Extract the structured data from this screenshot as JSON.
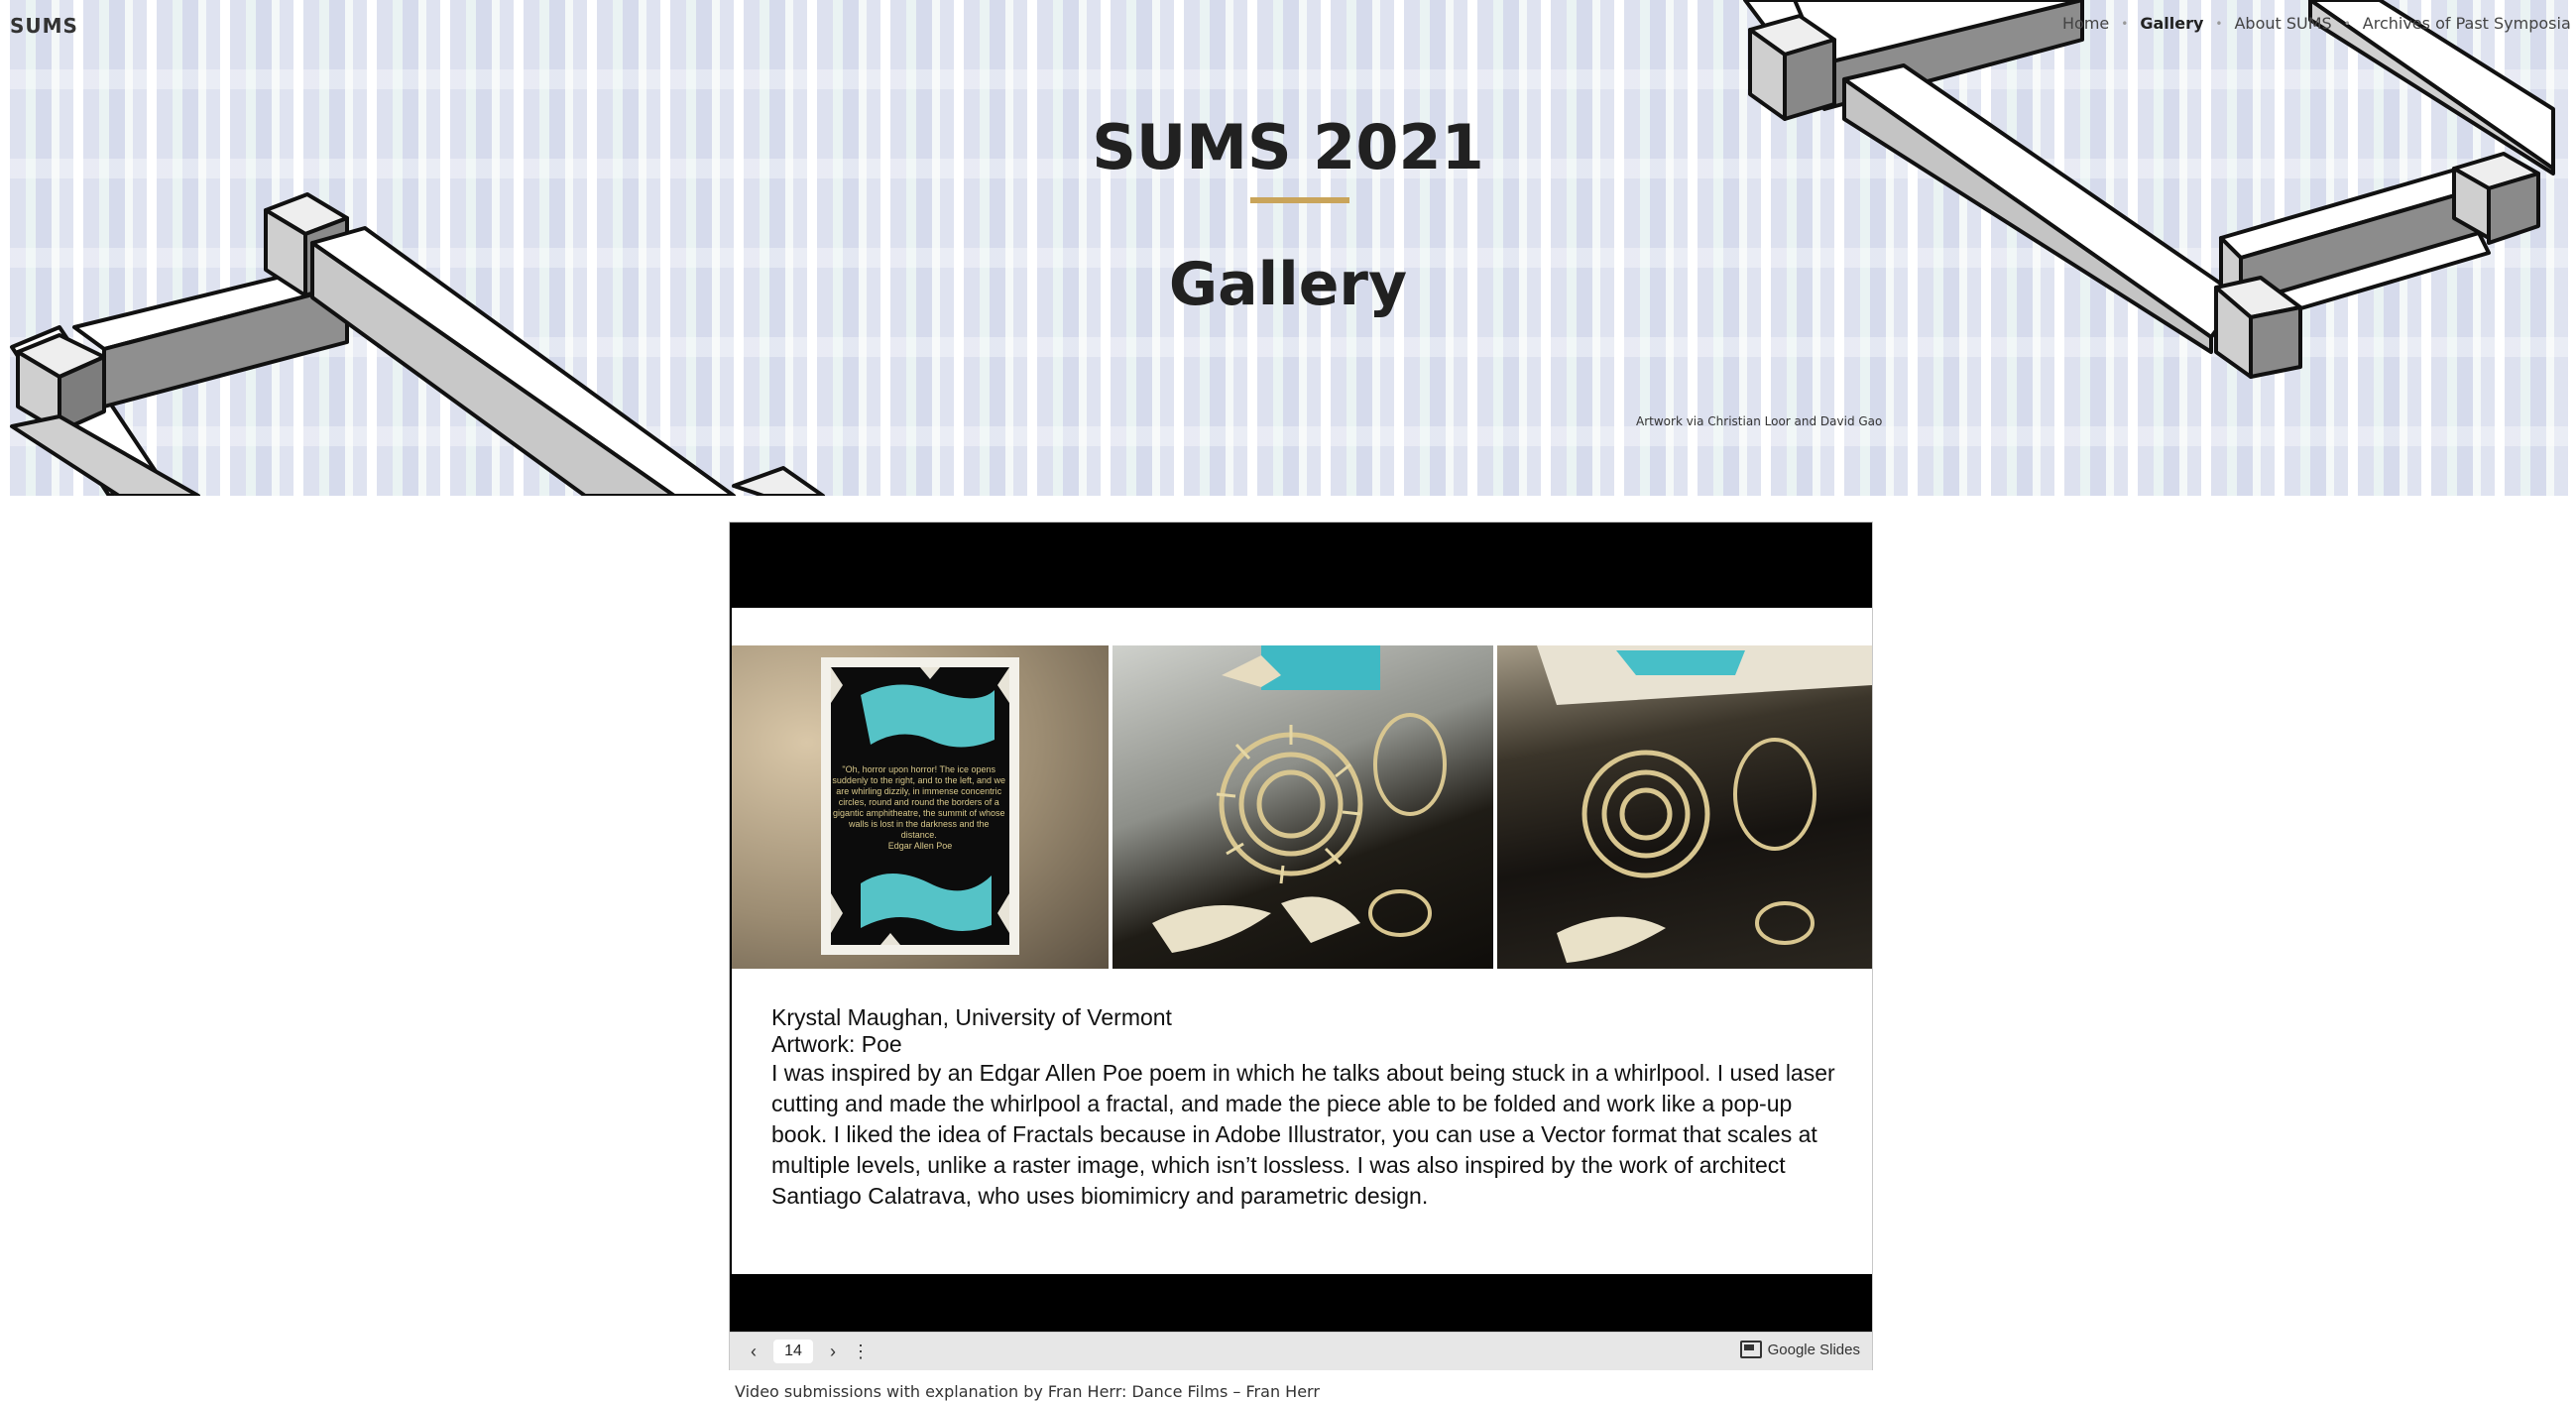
{
  "header": {
    "site_title": "SUMS",
    "nav": [
      {
        "label": "Home"
      },
      {
        "label": "Gallery",
        "active": true
      },
      {
        "label": "About SUMS"
      },
      {
        "label": "Archives of Past Symposia"
      }
    ]
  },
  "hero": {
    "title": "SUMS 2021",
    "subtitle": "Gallery",
    "credit": "Artwork via Christian Loor and David Gao",
    "accent_color": "#c9a45a"
  },
  "slide": {
    "poem_text": "\"Oh, horror upon horror! The ice opens suddenly to the right, and to the left, and we are whirling dizzily, in immense concentric circles, round and round the borders of a gigantic amphitheatre, the summit of whose walls is lost in the darkness and the distance. Edgar Allen Poe",
    "author": "Krystal Maughan, University of Vermont",
    "artwork": "Artwork: Poe",
    "description": "I was inspired by an Edgar Allen Poe poem in which he talks about being stuck in a whirlpool. I used laser cutting and made the whirlpool a fractal, and made the piece able to be folded and work like a pop-up book. I liked the idea of Fractals because in Adobe Illustrator, you can use a Vector format that scales at multiple levels, unlike a raster image, which isn’t lossless. I was also inspired by the work of architect Santiago Calatrava, who uses biomimicry and parametric design."
  },
  "controls": {
    "prev_icon": "chevron-left-icon",
    "page_number": "14",
    "next_icon": "chevron-right-icon",
    "menu_icon": "more-vertical-icon",
    "brand_label": "Google Slides"
  },
  "footer_note": "Video submissions with explanation by Fran Herr: Dance Films – Fran Herr"
}
